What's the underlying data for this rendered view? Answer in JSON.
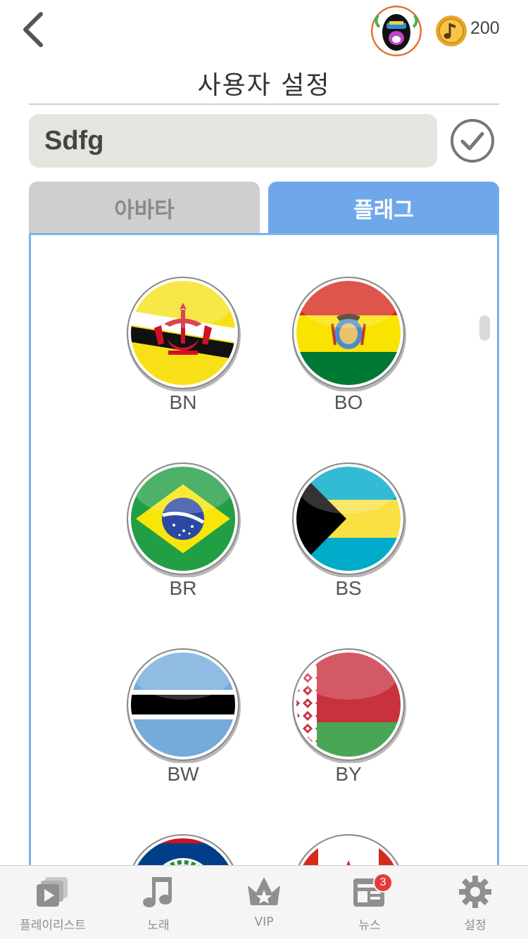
{
  "header": {
    "coin_count": "200",
    "title": "사용자 설정"
  },
  "profile": {
    "name_value": "Sdfg"
  },
  "tabs": [
    {
      "label": "아바타",
      "active": false
    },
    {
      "label": "플래그",
      "active": true
    }
  ],
  "flags": [
    {
      "code": "BN"
    },
    {
      "code": "BO"
    },
    {
      "code": "BR"
    },
    {
      "code": "BS"
    },
    {
      "code": "BW"
    },
    {
      "code": "BY"
    }
  ],
  "bottom_nav": [
    {
      "label": "플레이리스트",
      "icon": "playlist-icon"
    },
    {
      "label": "노래",
      "icon": "music-note-icon"
    },
    {
      "label": "VIP",
      "icon": "crown-icon"
    },
    {
      "label": "뉴스",
      "icon": "news-icon",
      "badge": "3"
    },
    {
      "label": "설정",
      "icon": "gear-icon"
    }
  ],
  "colors": {
    "accent": "#6fa8ea",
    "inactive_tab": "#cfcfcf",
    "input_bg": "#e6e4de",
    "badge": "#e23a3a"
  }
}
